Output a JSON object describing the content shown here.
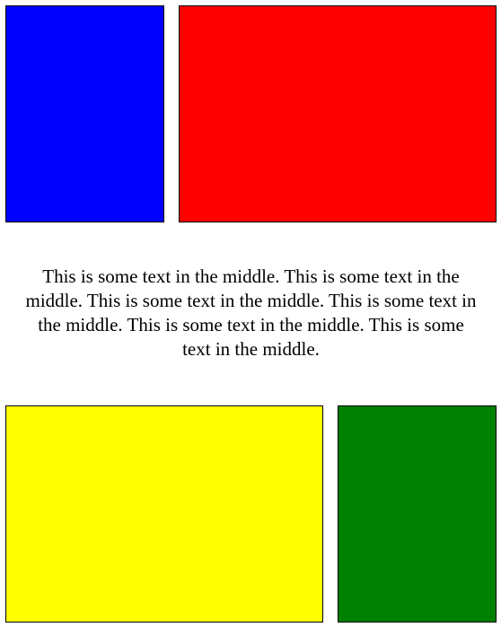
{
  "boxes": {
    "top_left": {
      "color": "#0000ff",
      "name": "blue"
    },
    "top_right": {
      "color": "#ff0000",
      "name": "red"
    },
    "bottom_left": {
      "color": "#ffff00",
      "name": "yellow"
    },
    "bottom_right": {
      "color": "#008000",
      "name": "green"
    }
  },
  "middle": {
    "text": "This is some text in the middle. This is some text in the middle. This is some text in the middle. This is some text in the middle. This is some text in the middle. This is some text in the middle."
  }
}
